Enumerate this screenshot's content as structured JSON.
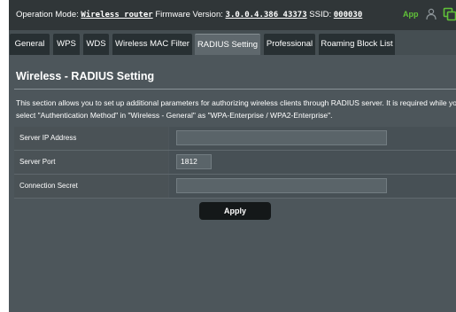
{
  "status": {
    "operation_mode_label": "Operation Mode:",
    "operation_mode_value": "Wireless router",
    "firmware_label": "Firmware Version:",
    "firmware_value": "3.0.0.4.386_43373",
    "ssid_label": "SSID:",
    "ssid_value": "000030",
    "app_label": "App",
    "icons": [
      "user-icon",
      "copy-icon"
    ]
  },
  "tabs": [
    {
      "label": "General",
      "active": false
    },
    {
      "label": "WPS",
      "active": false
    },
    {
      "label": "WDS",
      "active": false
    },
    {
      "label": "Wireless MAC Filter",
      "active": false
    },
    {
      "label": "RADIUS Setting",
      "active": true
    },
    {
      "label": "Professional",
      "active": false
    },
    {
      "label": "Roaming Block List",
      "active": false
    }
  ],
  "page": {
    "title": "Wireless - RADIUS Setting",
    "description": "This section allows you to set up additional parameters for authorizing wireless clients through RADIUS server. It is required while you select \"Authentication Method\" in \"Wireless - General\" as \"WPA-Enterprise / WPA2-Enterprise\"."
  },
  "form": {
    "server_ip": {
      "label": "Server IP Address",
      "value": ""
    },
    "server_port": {
      "label": "Server Port",
      "value": "1812"
    },
    "secret": {
      "label": "Connection Secret",
      "value": ""
    }
  },
  "apply_label": "Apply",
  "colors": {
    "background": "#4d565b",
    "app_accent": "#61c238",
    "button": "#141819"
  }
}
